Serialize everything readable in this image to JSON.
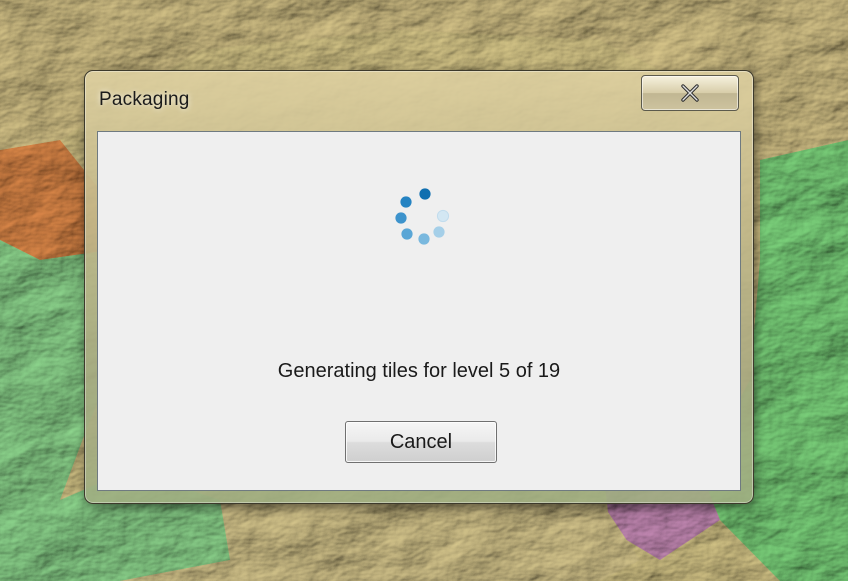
{
  "window": {
    "title": "Packaging",
    "close_icon": "close-x-icon"
  },
  "dialog": {
    "status_text": "Generating tiles for level 5 of 19",
    "progress": {
      "current_level": 5,
      "total_levels": 19
    },
    "spinner_icon": "busy-spinner-icon",
    "cancel_label": "Cancel"
  },
  "colors": {
    "spinner_accent": "#1a7fbf",
    "client_background": "#efefef"
  }
}
